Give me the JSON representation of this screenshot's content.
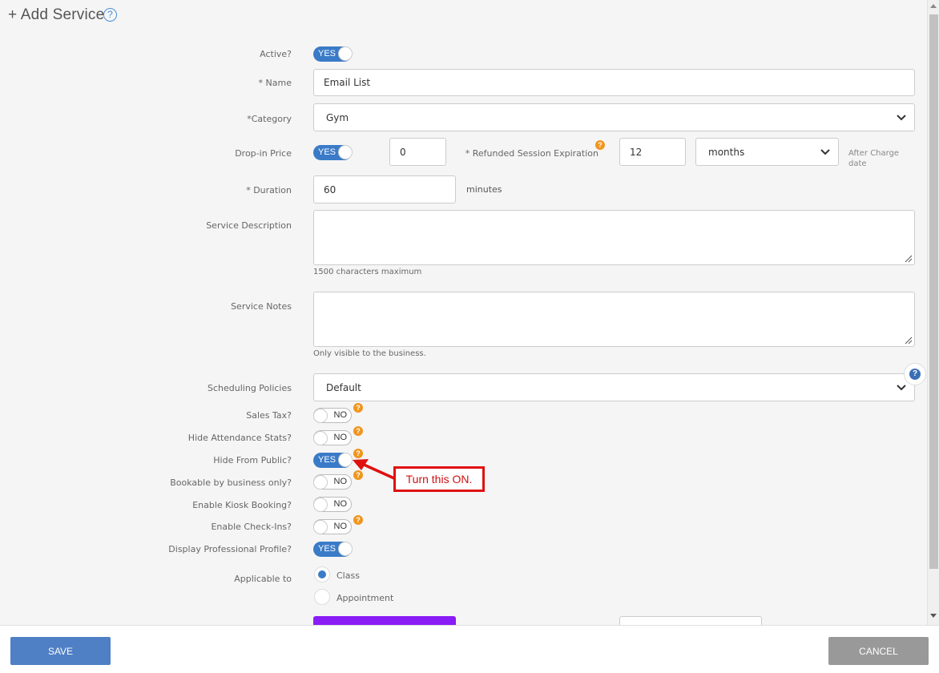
{
  "header": {
    "title": "+ Add Service",
    "help_icon": "question-circle-icon"
  },
  "form": {
    "active": {
      "label": "Active?",
      "state": "YES"
    },
    "name": {
      "label": "* Name",
      "value": "Email List"
    },
    "category": {
      "label": "*Category",
      "value": "Gym"
    },
    "drop_in": {
      "label": "Drop-in Price",
      "state": "YES",
      "price": "0",
      "refund_label": "* Refunded Session Expiration",
      "refund_value": "12",
      "refund_unit": "months",
      "after_charge": "After Charge date"
    },
    "duration": {
      "label": "* Duration",
      "value": "60",
      "unit": "minutes"
    },
    "description": {
      "label": "Service Description",
      "hint": "1500 characters maximum"
    },
    "notes": {
      "label": "Service Notes",
      "hint": "Only visible to the business."
    },
    "scheduling": {
      "label": "Scheduling Policies",
      "value": "Default"
    },
    "sales_tax": {
      "label": "Sales Tax?",
      "state": "NO"
    },
    "hide_attendance": {
      "label": "Hide Attendance Stats?",
      "state": "NO"
    },
    "hide_public": {
      "label": "Hide From Public?",
      "state": "YES"
    },
    "bookable_business": {
      "label": "Bookable by business only?",
      "state": "NO"
    },
    "kiosk": {
      "label": "Enable Kiosk Booking?",
      "state": "NO"
    },
    "checkins": {
      "label": "Enable Check-Ins?",
      "state": "NO"
    },
    "pro_profile": {
      "label": "Display Professional Profile?",
      "state": "YES"
    },
    "applicable": {
      "label": "Applicable to",
      "options": [
        "Class",
        "Appointment"
      ],
      "selected": "Class"
    },
    "q_mark": "?"
  },
  "callout": {
    "text": "Turn this ON."
  },
  "footer": {
    "save": "SAVE",
    "cancel": "CANCEL"
  },
  "colors": {
    "accent": "#3a7bc8",
    "save": "#4f7fc4",
    "cancel": "#999999",
    "callout": "#e01010",
    "help_orange": "#f0961e",
    "purple": "#8a1cf5"
  }
}
